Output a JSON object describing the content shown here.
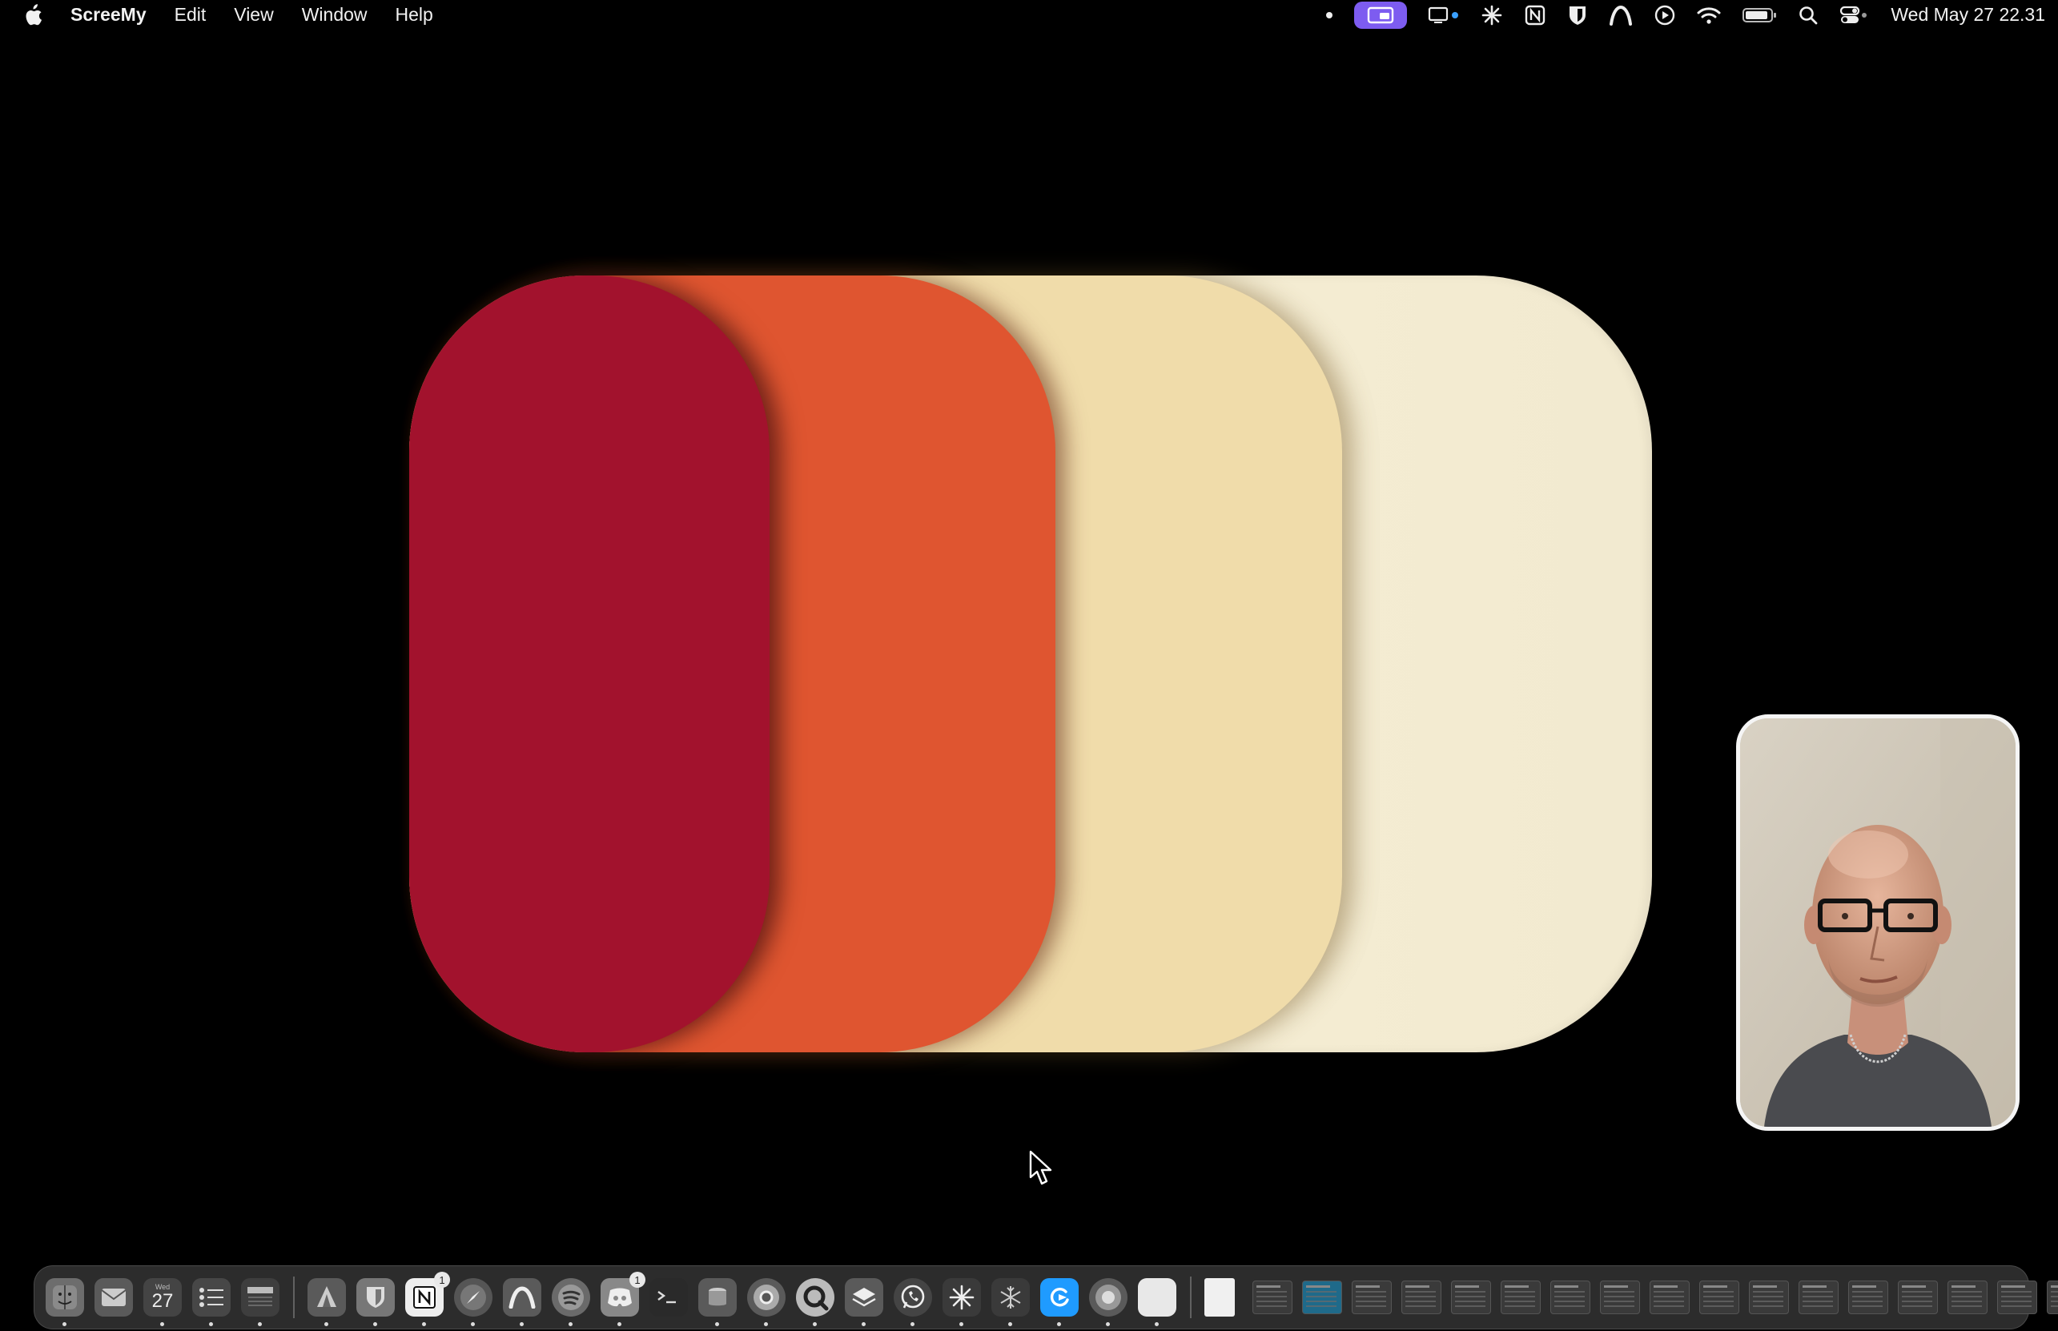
{
  "menubar": {
    "app_name": "ScreeMy",
    "menus": [
      "Edit",
      "View",
      "Window",
      "Help"
    ],
    "clock": "Wed May 27  22.31",
    "status_icons": [
      "dot-icon",
      "screen-share-icon",
      "display-icon",
      "asterisk-icon",
      "notion-icon",
      "bitwarden-icon",
      "arc-icon",
      "play-icon",
      "wifi-icon",
      "battery-icon",
      "search-icon",
      "control-center-icon"
    ]
  },
  "artwork": {
    "colors": {
      "red": "#a2122d",
      "orange": "#df5530",
      "sand": "#f0dcaa",
      "cream": "#f2ead0"
    }
  },
  "camera": {
    "label": "webcam-overlay"
  },
  "dock": {
    "calendar_day": "27",
    "calendar_month": "Wed",
    "badges": {
      "notion": "1",
      "discord": "1"
    },
    "apps": [
      "finder",
      "mail",
      "calendar",
      "reminders",
      "notes",
      "affinity",
      "bitwarden",
      "notion",
      "safari",
      "arc",
      "spotify",
      "discord",
      "terminal",
      "disk-utility",
      "chrome",
      "quicktime",
      "stack",
      "whatsapp",
      "perplexity",
      "snowflake",
      "screemy",
      "browser",
      "blank"
    ]
  }
}
